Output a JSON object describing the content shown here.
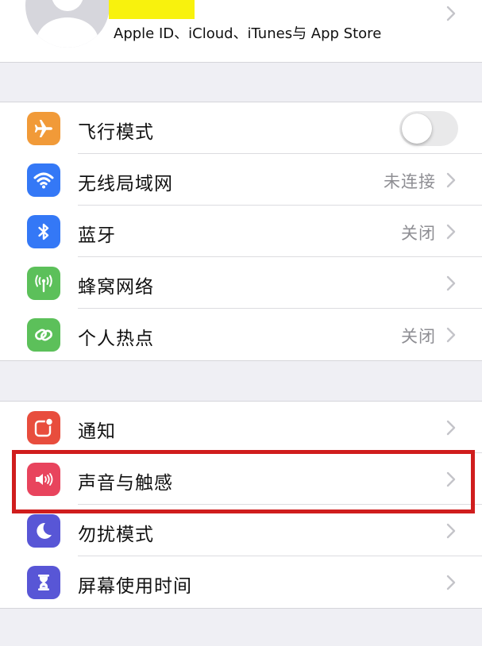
{
  "profile": {
    "subtitle": "Apple ID、iCloud、iTunes与 App Store",
    "highlight_color": "#f8f20d"
  },
  "groups": [
    {
      "rows": [
        {
          "id": "airplane",
          "label": "飞行模式",
          "icon": "airplane-icon",
          "icon_color": "#f19a38",
          "toggle": "off"
        },
        {
          "id": "wifi",
          "label": "无线局域网",
          "value": "未连接",
          "icon": "wifi-icon",
          "icon_color": "#3478f6"
        },
        {
          "id": "bluetooth",
          "label": "蓝牙",
          "value": "关闭",
          "icon": "bluetooth-icon",
          "icon_color": "#3478f6"
        },
        {
          "id": "cellular",
          "label": "蜂窝网络",
          "icon": "cellular-antenna-icon",
          "icon_color": "#5cc05a"
        },
        {
          "id": "hotspot",
          "label": "个人热点",
          "value": "关闭",
          "icon": "hotspot-chain-icon",
          "icon_color": "#5cc05a"
        }
      ]
    },
    {
      "rows": [
        {
          "id": "notifications",
          "label": "通知",
          "icon": "notifications-icon",
          "icon_color": "#e84d3d"
        },
        {
          "id": "sounds",
          "label": "声音与触感",
          "icon": "speaker-icon",
          "icon_color": "#e8445d",
          "highlighted": true
        },
        {
          "id": "dnd",
          "label": "勿扰模式",
          "icon": "moon-icon",
          "icon_color": "#5856d6"
        },
        {
          "id": "screentime",
          "label": "屏幕使用时间",
          "icon": "hourglass-icon",
          "icon_color": "#5856d6"
        }
      ]
    }
  ],
  "annotation": {
    "color": "#d01d1d",
    "target": "sounds"
  }
}
